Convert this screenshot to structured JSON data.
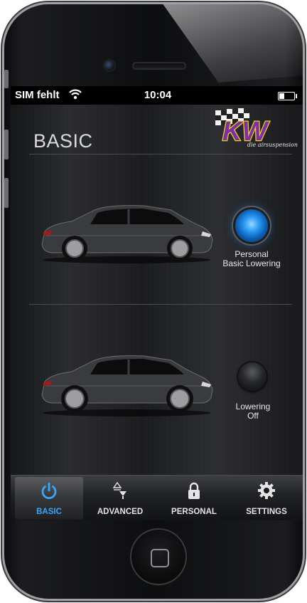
{
  "status_bar": {
    "carrier": "SIM fehlt",
    "time": "10:04",
    "icons": {
      "wifi": "wifi-icon",
      "battery": "battery-icon"
    }
  },
  "header": {
    "title": "BASIC",
    "logo_text": "KW",
    "logo_tagline": "die airsuspension"
  },
  "modes": [
    {
      "name": "personal-basic-lowering",
      "label_line1": "Personal",
      "label_line2": "Basic Lowering",
      "active": true
    },
    {
      "name": "lowering-off",
      "label_line1": "Lowering",
      "label_line2": "Off",
      "active": false
    }
  ],
  "tabs": [
    {
      "label": "BASIC",
      "icon": "power-icon",
      "active": true
    },
    {
      "label": "ADVANCED",
      "icon": "advanced-arrows-icon",
      "active": false
    },
    {
      "label": "PERSONAL",
      "icon": "lock-icon",
      "active": false
    },
    {
      "label": "SETTINGS",
      "icon": "gear-icon",
      "active": false
    }
  ],
  "colors": {
    "accent": "#37a6ff",
    "logo_purple": "#7b2fa8",
    "logo_yellow": "#f2d21b"
  }
}
